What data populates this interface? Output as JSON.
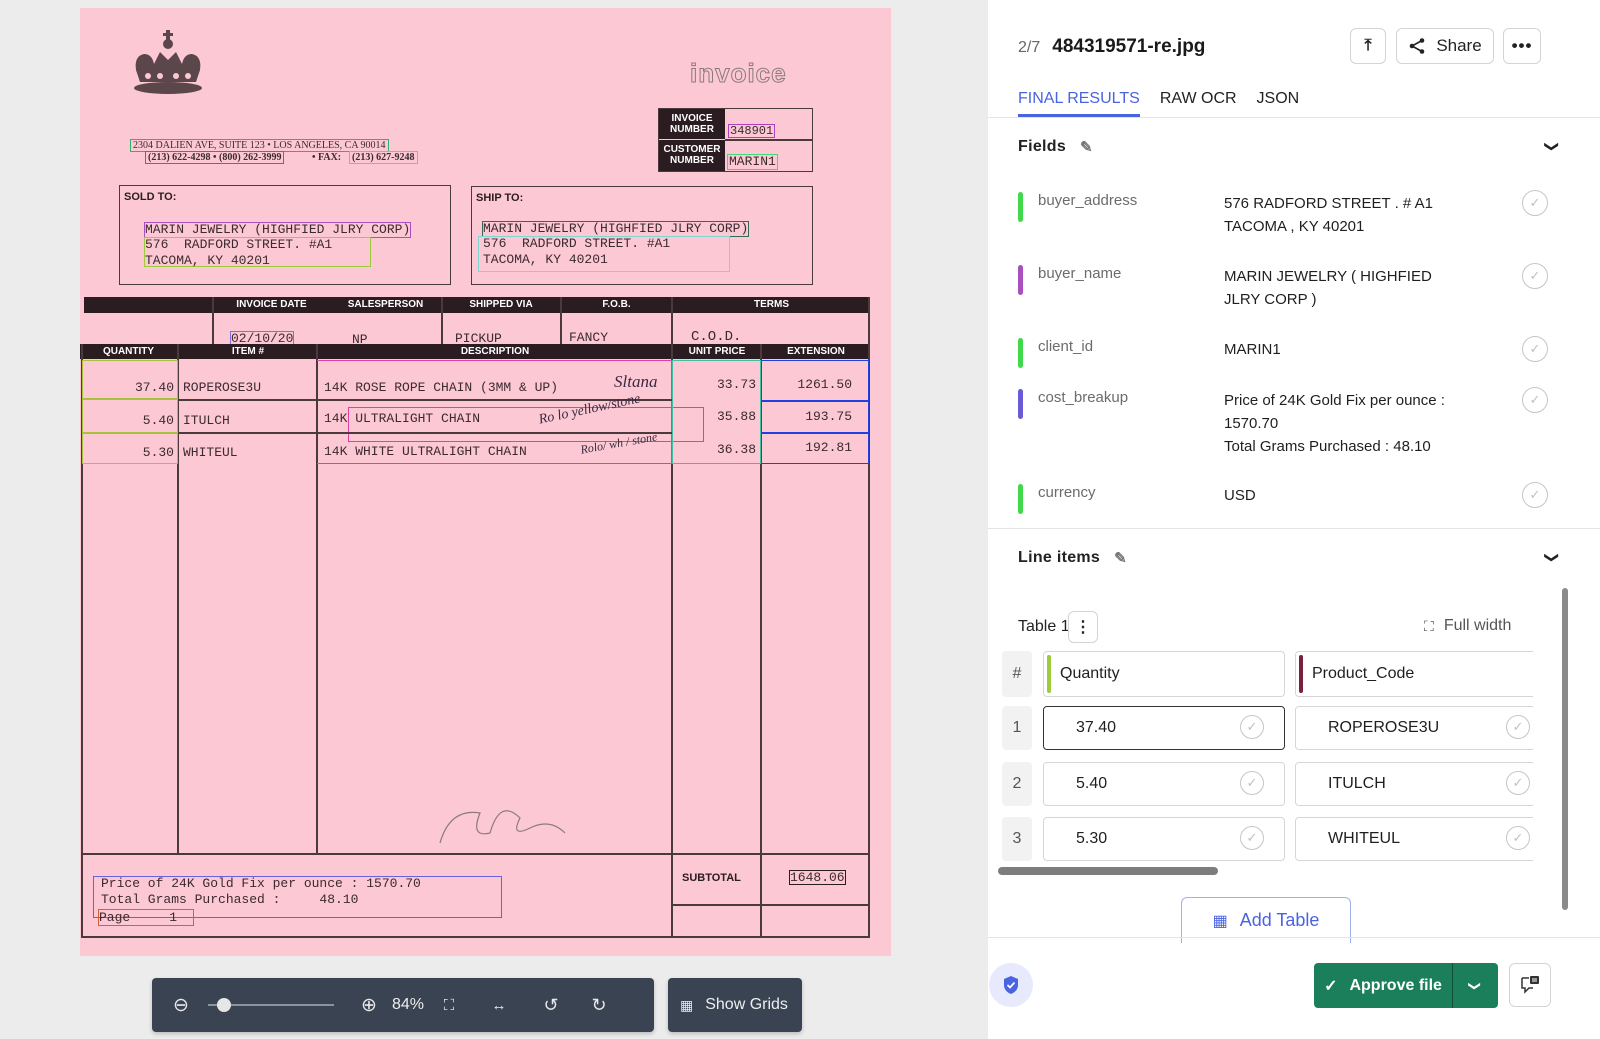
{
  "viewer": {
    "document": {
      "logo_text": "invoice",
      "company_address": "2304 DALIEN AVE, SUITE 123  •  LOS ANGELES, CA 90014",
      "company_phone": "(213) 622-4298 • (800) 262-3999",
      "company_fax_label": "• FAX:",
      "company_fax": "(213) 627-9248",
      "invoice_number_label": "INVOICE NUMBER",
      "invoice_number": "348901",
      "customer_number_label": "CUSTOMER NUMBER",
      "customer_number": "MARIN1",
      "sold_to_label": "SOLD TO:",
      "ship_to_label": "SHIP TO:",
      "sold_to": {
        "name": "MARIN JEWELRY (HIGHFIED JLRY CORP)",
        "street": "576  RADFORD STREET. #A1",
        "city": "TACOMA, KY 40201"
      },
      "ship_to": {
        "name": "MARIN JEWELRY (HIGHFIED JLRY CORP)",
        "street": "576  RADFORD STREET. #A1",
        "city": "TACOMA, KY 40201"
      },
      "meta_headers": [
        "INVOICE DATE",
        "SALESPERSON",
        "SHIPPED VIA",
        "F.O.B.",
        "TERMS"
      ],
      "meta_values": [
        "02/10/20",
        "NP",
        "PICKUP",
        "FANCY",
        "C.O.D."
      ],
      "item_headers": [
        "QUANTITY",
        "ITEM #",
        "DESCRIPTION",
        "UNIT PRICE",
        "EXTENSION"
      ],
      "items": [
        {
          "qty": "37.40",
          "item": "ROPEROSE3U",
          "desc": "14K ROSE ROPE CHAIN (3MM & UP)",
          "note": "Sltana",
          "unit": "33.73",
          "ext": "1261.50"
        },
        {
          "qty": "5.40",
          "item": "ITULCH",
          "desc": "14K ULTRALIGHT CHAIN",
          "note": "Ro lo yellow/stone",
          "unit": "35.88",
          "ext": "193.75"
        },
        {
          "qty": "5.30",
          "item": "WHITEUL",
          "desc": "14K WHITE ULTRALIGHT CHAIN",
          "note": "Rolo/ wh / stone",
          "unit": "36.38",
          "ext": "192.81"
        }
      ],
      "cost_line1": "Price of 24K Gold Fix per ounce : 1570.70",
      "cost_line2": "Total Grams Purchased :     48.10",
      "page_label": "Page     1",
      "subtotal_label": "SUBTOTAL",
      "subtotal_value": "1648.06"
    },
    "toolbar": {
      "zoom_level": "84%",
      "zoom_slider_fraction": 0.08,
      "show_grids_label": "Show Grids"
    }
  },
  "panel": {
    "counter": "2/7",
    "filename": "484319571-re.jpg",
    "share_label": "Share",
    "tabs": [
      {
        "label": "FINAL RESULTS",
        "active": true
      },
      {
        "label": "RAW OCR",
        "active": false
      },
      {
        "label": "JSON",
        "active": false
      }
    ],
    "fields_title": "Fields",
    "fields": [
      {
        "name": "buyer_address",
        "value": "576 RADFORD STREET . # A1\nTACOMA , KY 40201",
        "color": "#3fd94a"
      },
      {
        "name": "buyer_name",
        "value": "MARIN JEWELRY ( HIGHFIED\nJLRY CORP )",
        "color": "#a94fc0"
      },
      {
        "name": "client_id",
        "value": "MARIN1",
        "color": "#3fd94a"
      },
      {
        "name": "cost_breakup",
        "value": "Price of 24K Gold Fix per ounce :\n1570.70\nTotal Grams Purchased : 48.10",
        "color": "#6a5ad8"
      },
      {
        "name": "currency",
        "value": "USD",
        "color": "#3fd94a"
      }
    ],
    "line_items_title": "Line items",
    "table": {
      "name": "Table 1",
      "full_width_label": "Full width",
      "index_header": "#",
      "columns": [
        {
          "label": "Quantity",
          "color": "#9ccc3c"
        },
        {
          "label": "Product_Code",
          "color": "#7a1f3d"
        }
      ],
      "rows": [
        {
          "index": "1",
          "cells": [
            "37.40",
            "ROPEROSE3U"
          ]
        },
        {
          "index": "2",
          "cells": [
            "5.40",
            "ITULCH"
          ]
        },
        {
          "index": "3",
          "cells": [
            "5.30",
            "WHITEUL"
          ]
        }
      ]
    },
    "add_table_label": "Add Table",
    "approve_label": "Approve file",
    "colors": {
      "accent": "#4a63e0",
      "approve": "#1b7f5b"
    }
  }
}
